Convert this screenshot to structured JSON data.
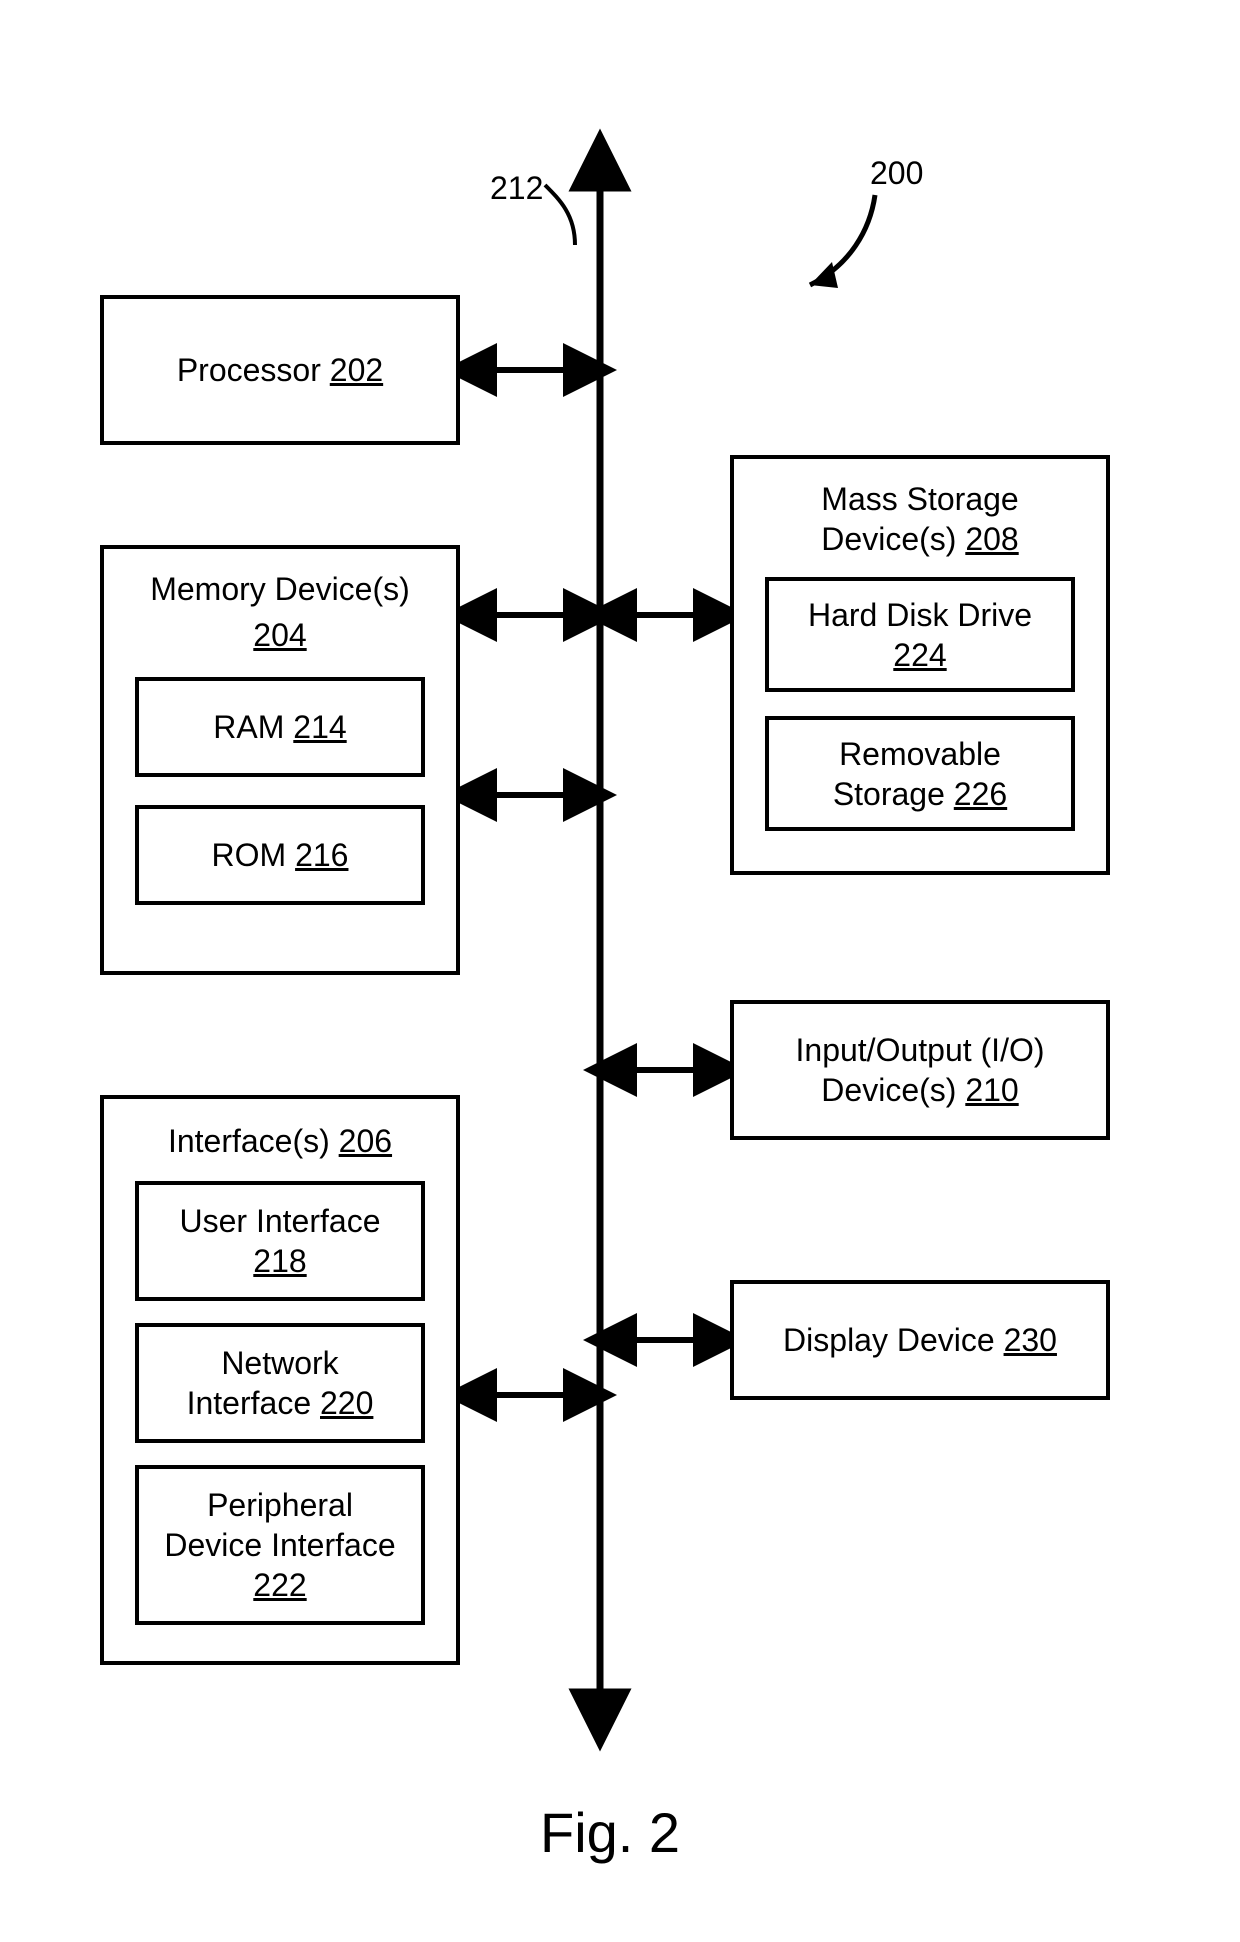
{
  "figure": {
    "caption": "Fig. 2",
    "system_ref": "200",
    "bus_ref": "212"
  },
  "blocks": {
    "processor": {
      "label": "Processor",
      "ref": "202"
    },
    "memory": {
      "label": "Memory Device(s)",
      "ref": "204",
      "ram": {
        "label": "RAM",
        "ref": "214"
      },
      "rom": {
        "label": "ROM",
        "ref": "216"
      }
    },
    "interfaces": {
      "label": "Interface(s)",
      "ref": "206",
      "user": {
        "label": "User Interface",
        "ref": "218"
      },
      "network": {
        "label_line1": "Network",
        "label_line2": "Interface",
        "ref": "220"
      },
      "peripheral": {
        "label_line1": "Peripheral",
        "label_line2": "Device Interface",
        "ref": "222"
      }
    },
    "mass_storage": {
      "label_line1": "Mass Storage",
      "label_line2": "Device(s)",
      "ref": "208",
      "hdd": {
        "label": "Hard Disk Drive",
        "ref": "224"
      },
      "removable": {
        "label_line1": "Removable",
        "label_line2": "Storage",
        "ref": "226"
      }
    },
    "io": {
      "label_line1": "Input/Output (I/O)",
      "label_line2": "Device(s)",
      "ref": "210"
    },
    "display": {
      "label": "Display Device",
      "ref": "230"
    }
  }
}
